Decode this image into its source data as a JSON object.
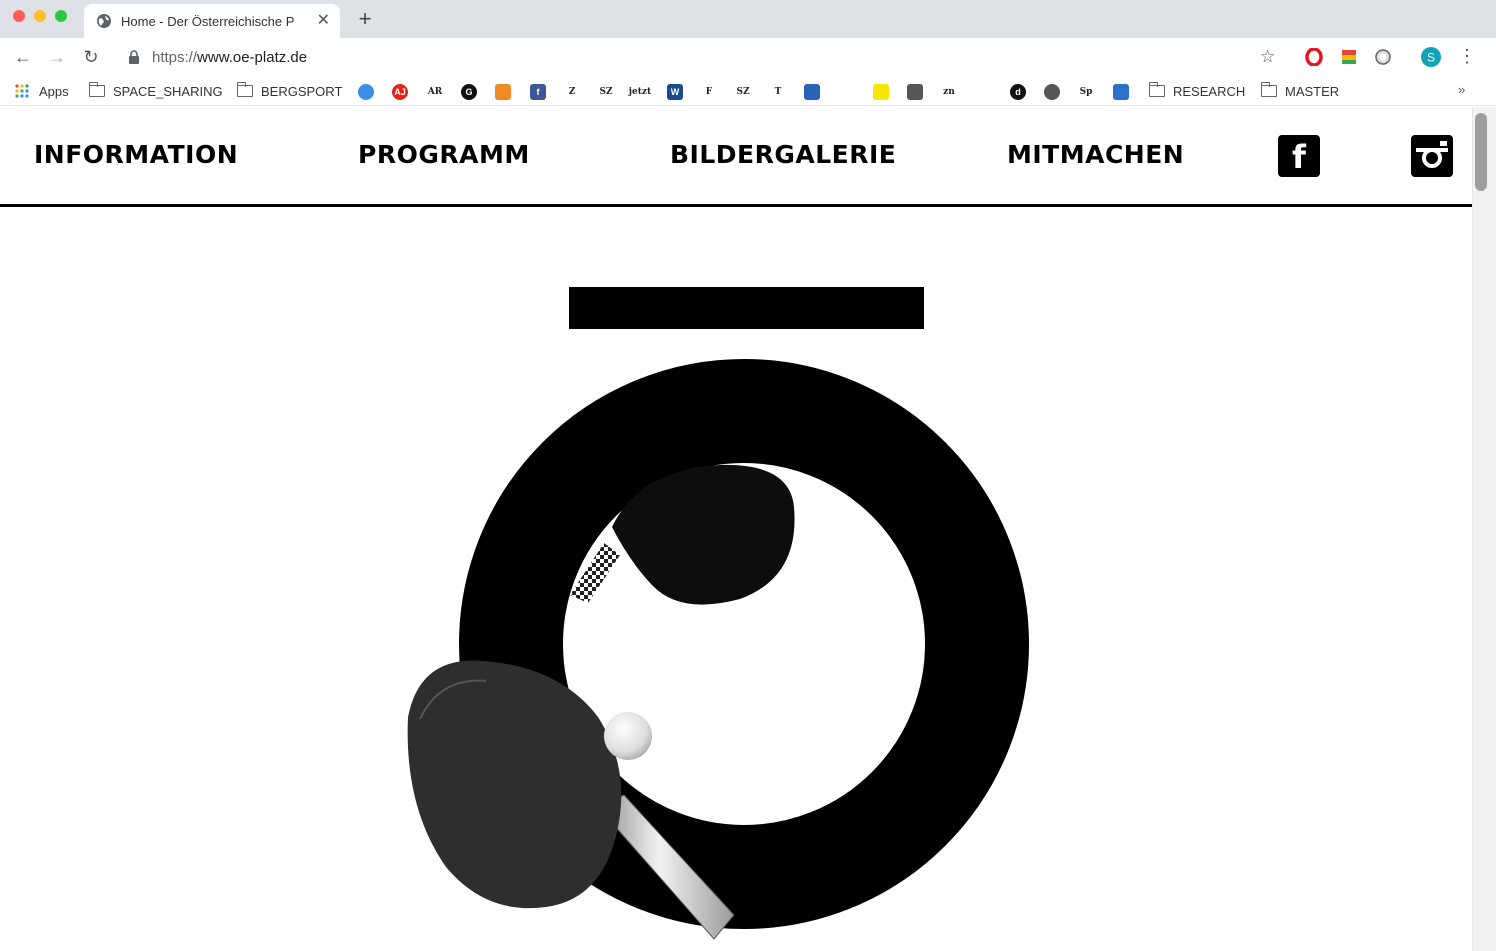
{
  "browser": {
    "tab_title": "Home - Der Österreichische P",
    "tab_close": "✕",
    "new_tab": "+",
    "url_scheme": "https://",
    "url_host": "www.oe-platz.de",
    "menu": "⋮",
    "profile_initial": "S"
  },
  "bookmarks": {
    "apps_label": "Apps",
    "folders": [
      "SPACE_SHARING",
      "BERGSPORT",
      "RESEARCH",
      "MASTER"
    ],
    "overflow": "»",
    "favicons": [
      {
        "icon": "blue-circle-icon",
        "color": "#3a8ee6",
        "text": ""
      },
      {
        "icon": "aj-icon",
        "color": "#e2231a",
        "text": "AJ"
      },
      {
        "icon": "ar-icon",
        "color": "#ffffff",
        "text": "AR"
      },
      {
        "icon": "g-icon",
        "color": "#111111",
        "text": "G"
      },
      {
        "icon": "orange-photo-icon",
        "color": "#f08a24",
        "text": ""
      },
      {
        "icon": "facebook-icon",
        "color": "#3b5998",
        "text": "f"
      },
      {
        "icon": "zeit-icon",
        "color": "#ffffff",
        "text": "Z"
      },
      {
        "icon": "sz-icon",
        "color": "#ffffff",
        "text": "SZ"
      },
      {
        "icon": "text-icon",
        "color": "#ffffff",
        "text": "jetzt"
      },
      {
        "icon": "w-icon",
        "color": "#1a4b8c",
        "text": "W"
      },
      {
        "icon": "faz-icon",
        "color": "#ffffff",
        "text": "F"
      },
      {
        "icon": "sz2-icon",
        "color": "#ffffff",
        "text": "SZ"
      },
      {
        "icon": "nyt-icon",
        "color": "#ffffff",
        "text": "T"
      },
      {
        "icon": "hand-icon",
        "color": "#2a62b8",
        "text": ""
      },
      {
        "icon": "grid-icon",
        "color": "#ffffff",
        "text": ""
      },
      {
        "icon": "yellow-figure-icon",
        "color": "#f6e600",
        "text": ""
      },
      {
        "icon": "building-icon",
        "color": "#555555",
        "text": ""
      },
      {
        "icon": "zen-icon",
        "color": "#ffffff",
        "text": "zn"
      },
      {
        "icon": "corner-icon",
        "color": "#ffffff",
        "text": ""
      },
      {
        "icon": "d-icon",
        "color": "#111111",
        "text": "d"
      },
      {
        "icon": "globe-icon",
        "color": "#555555",
        "text": ""
      },
      {
        "icon": "sp-icon",
        "color": "#ffffff",
        "text": "Sp"
      },
      {
        "icon": "dots-icon",
        "color": "#2b70c9",
        "text": ""
      }
    ]
  },
  "site": {
    "nav": [
      "INFORMATION",
      "PROGRAMM",
      "BILDERGALERIE",
      "MITMACHEN"
    ],
    "facebook": "f",
    "hero": {
      "logo": "ō",
      "image": "table-tennis-paddles-and-ball"
    }
  },
  "colors": {
    "brand": "#000000",
    "background": "#ffffff"
  }
}
